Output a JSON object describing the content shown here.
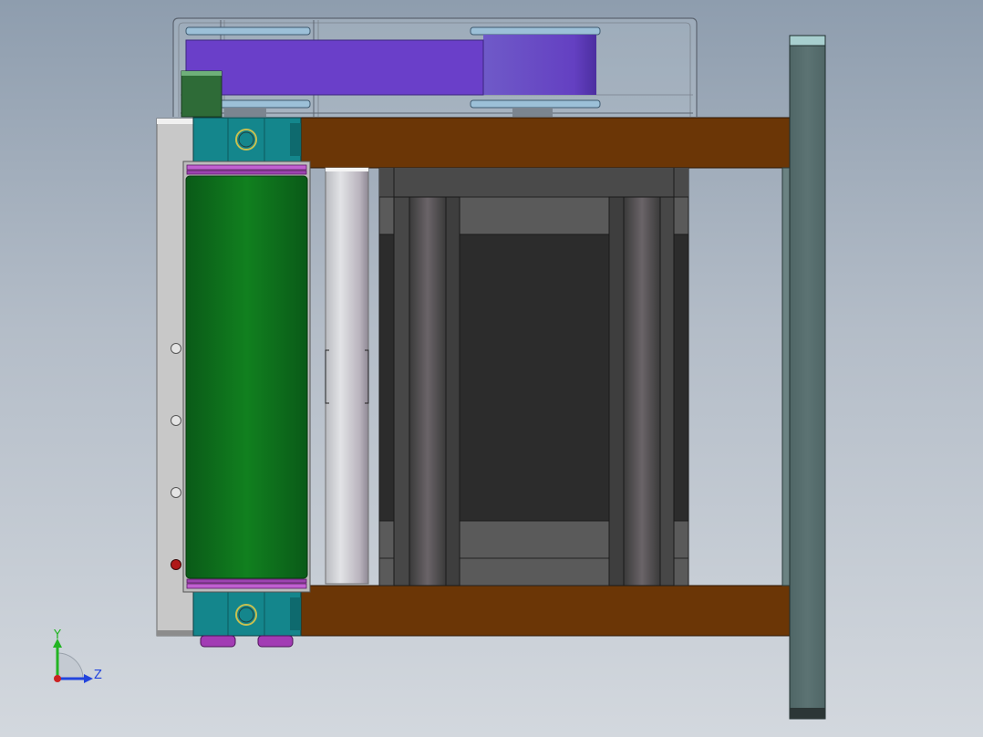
{
  "triad": {
    "y_label": "Y",
    "z_label": "Z",
    "y_color": "#22b422",
    "z_color": "#2244dd",
    "x_color": "#cc2222"
  },
  "colors": {
    "frame_brown": "#6b3606",
    "side_plate": "#586f6f",
    "side_plate_top": "#a8cfcf",
    "bearing_teal": "#14868c",
    "roller_green": "#0c6c1c",
    "belt_purple": "#6a3fc9",
    "pulley_blue": "#9cc0d8",
    "flange_magenta": "#b44cc4",
    "motor_dark": "#2c2c2c",
    "motor_gray": "#5a5a5a",
    "idler_silver": "#cfd0d4",
    "guard_outline": "#5c6470",
    "left_panel": "#c8c8c8",
    "indicator_red": "#b01818"
  },
  "icons": {
    "view_triad": "coordinate-triad-icon"
  }
}
